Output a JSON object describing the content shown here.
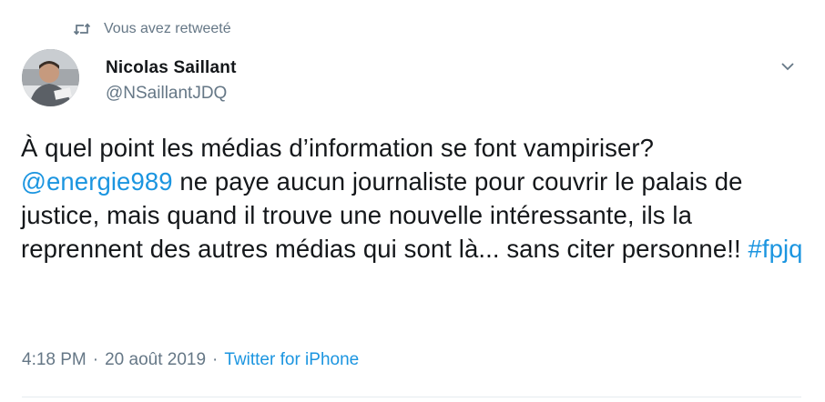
{
  "retweet": {
    "icon": "retweet-icon",
    "label": "Vous avez retweeté"
  },
  "user": {
    "avatar_icon": "avatar-photo",
    "name": "Nicolas Saillant",
    "handle": "@NSaillantJDQ"
  },
  "menu": {
    "icon": "chevron-down-icon"
  },
  "tweet": {
    "text_before_mention": "À quel point les médias d’information se font vampiriser? ",
    "mention": "@energie989",
    "text_after_mention": " ne paye aucun journaliste pour couvrir le palais de justice, mais quand il trouve une nouvelle intéressante, ils la reprennent des autres médias qui sont là... sans citer personne!! ",
    "hashtag": "#fpjq"
  },
  "meta": {
    "time": "4:18 PM",
    "separator_1": "·",
    "date": "20 août 2019",
    "separator_2": "·",
    "source": "Twitter for iPhone"
  },
  "colors": {
    "link": "#1b95e0",
    "secondary_text": "#657786",
    "primary_text": "#14171a",
    "divider": "#e6ecf0"
  }
}
